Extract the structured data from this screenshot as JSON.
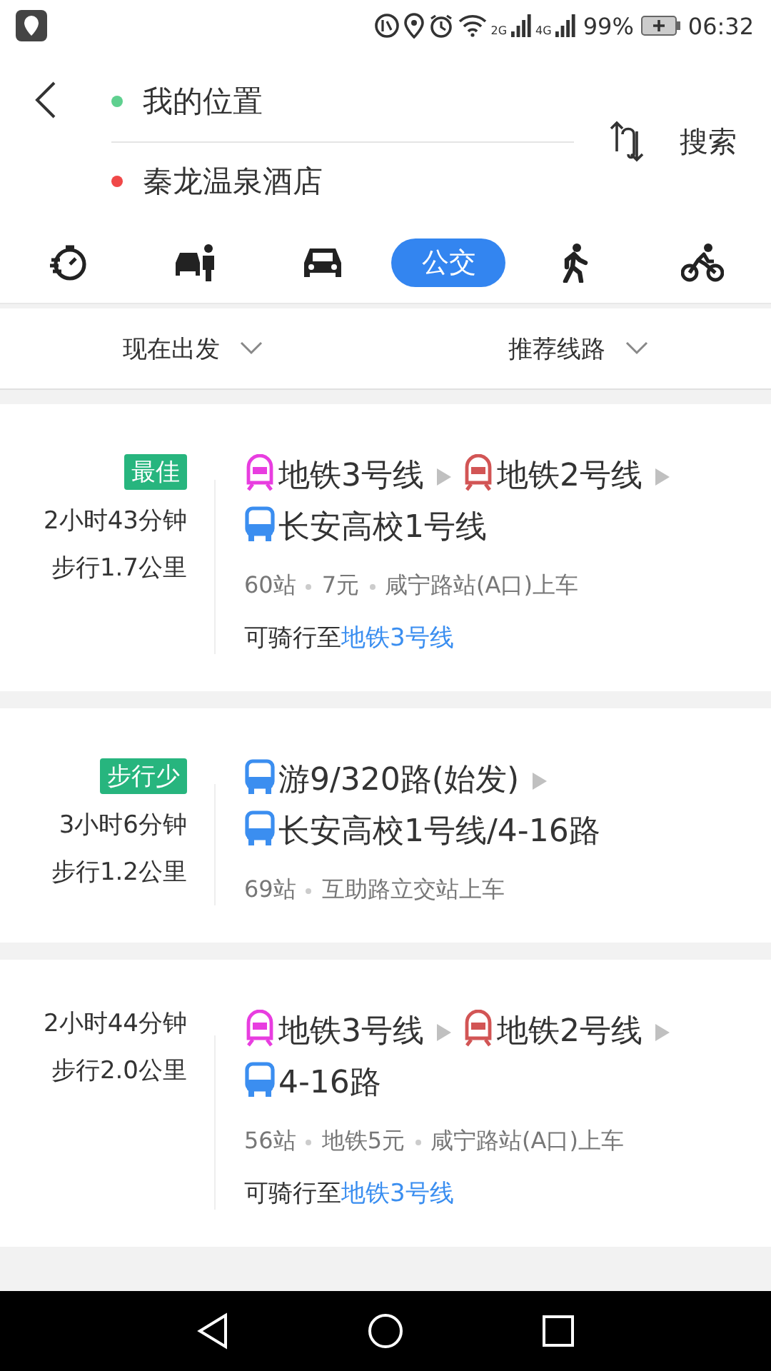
{
  "status_bar": {
    "network_labels": [
      "2G",
      "4G"
    ],
    "battery": "99%",
    "time": "06:32"
  },
  "header": {
    "origin": {
      "text": "我的位置",
      "color": "#5fd08f"
    },
    "destination": {
      "text": "秦龙温泉酒店",
      "color": "#f04848"
    },
    "search": "搜索"
  },
  "modes": [
    {
      "kind": "timer",
      "selected": false
    },
    {
      "kind": "taxi",
      "selected": false
    },
    {
      "kind": "car",
      "selected": false
    },
    {
      "kind": "bus",
      "label": "公交",
      "selected": true
    },
    {
      "kind": "walk",
      "selected": false
    },
    {
      "kind": "bike",
      "selected": false
    }
  ],
  "filters": [
    "现在出发",
    "推荐线路"
  ],
  "routes": [
    {
      "badge": "最佳",
      "duration": "2小时43分钟",
      "walk": "步行1.7公里",
      "segments": [
        {
          "kind": "metro",
          "name": "地铁3号线",
          "color": "#e83de0"
        },
        {
          "kind": "metro",
          "name": "地铁2号线",
          "color": "#d25555"
        },
        {
          "kind": "bus",
          "name": "长安高校1号线",
          "color": "#3b8ef0"
        }
      ],
      "info": [
        "60站",
        "7元",
        "咸宁路站(A口)上车"
      ],
      "ride": {
        "prefix": "可骑行至",
        "link": "地铁3号线"
      }
    },
    {
      "badge": "步行少",
      "duration": "3小时6分钟",
      "walk": "步行1.2公里",
      "segments": [
        {
          "kind": "bus",
          "name": "游9/320路(始发)",
          "color": "#3b8ef0"
        },
        {
          "kind": "bus",
          "name": "长安高校1号线/4-16路",
          "color": "#3b8ef0"
        }
      ],
      "info": [
        "69站",
        "互助路立交站上车"
      ]
    },
    {
      "duration": "2小时44分钟",
      "walk": "步行2.0公里",
      "segments": [
        {
          "kind": "metro",
          "name": "地铁3号线",
          "color": "#e83de0"
        },
        {
          "kind": "metro",
          "name": "地铁2号线",
          "color": "#d25555"
        },
        {
          "kind": "bus",
          "name": "4-16路",
          "color": "#3b8ef0"
        }
      ],
      "info": [
        "56站",
        "地铁5元",
        "咸宁路站(A口)上车"
      ],
      "ride": {
        "prefix": "可骑行至",
        "link": "地铁3号线"
      }
    }
  ]
}
